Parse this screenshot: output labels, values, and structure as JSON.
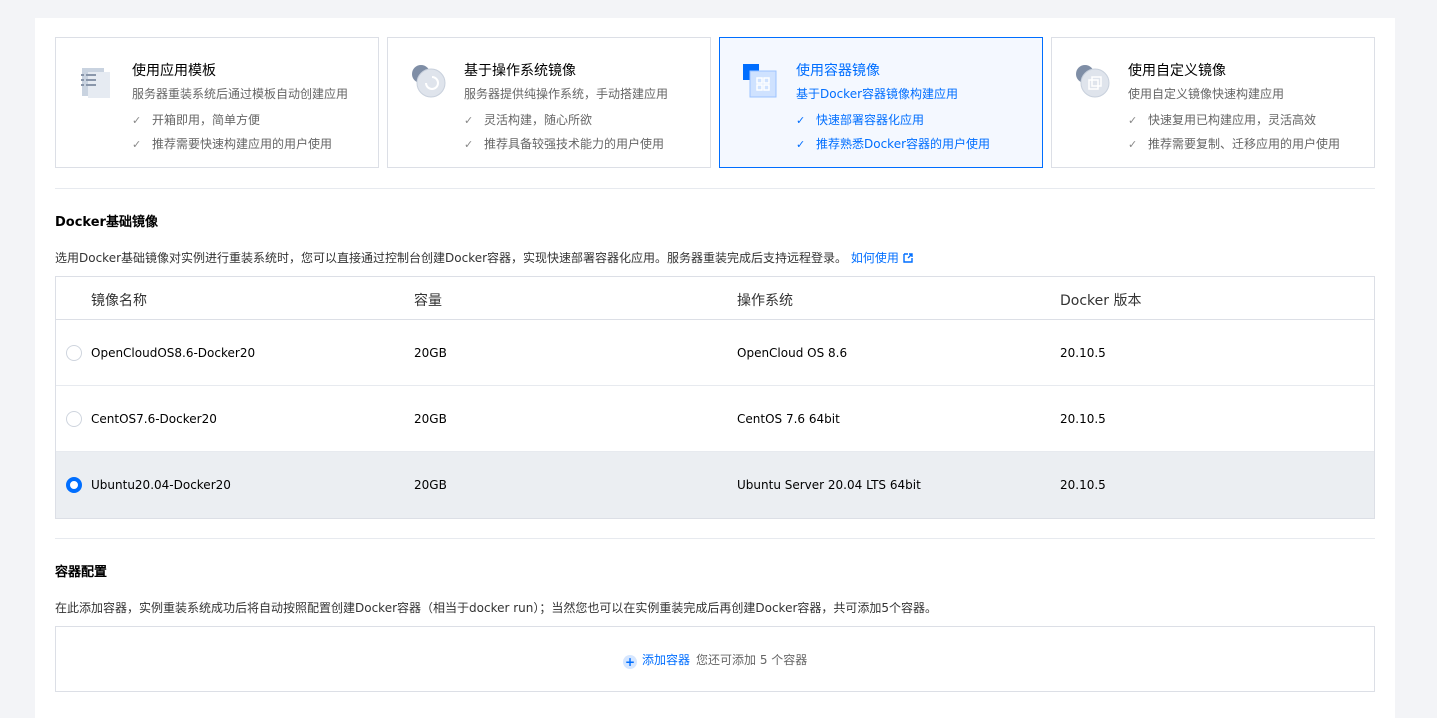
{
  "cards": [
    {
      "title": "使用应用模板",
      "desc": "服务器重装系统后通过模板自动创建应用",
      "features": [
        "开箱即用，简单方便",
        "推荐需要快速构建应用的用户使用"
      ],
      "icon": "app-template-icon",
      "active": false
    },
    {
      "title": "基于操作系统镜像",
      "desc": "服务器提供纯操作系统，手动搭建应用",
      "features": [
        "灵活构建，随心所欲",
        "推荐具备较强技术能力的用户使用"
      ],
      "icon": "os-image-icon",
      "active": false
    },
    {
      "title": "使用容器镜像",
      "desc": "基于Docker容器镜像构建应用",
      "features": [
        "快速部署容器化应用",
        "推荐熟悉Docker容器的用户使用"
      ],
      "icon": "container-image-icon",
      "active": true
    },
    {
      "title": "使用自定义镜像",
      "desc": "使用自定义镜像快速构建应用",
      "features": [
        "快速复用已构建应用，灵活高效",
        "推荐需要复制、迁移应用的用户使用"
      ],
      "icon": "custom-image-icon",
      "active": false
    }
  ],
  "docker": {
    "title": "Docker基础镜像",
    "desc": "选用Docker基础镜像对实例进行重装系统时，您可以直接通过控制台创建Docker容器，实现快速部署容器化应用。服务器重装完成后支持远程登录。",
    "link": "如何使用",
    "columns": [
      "镜像名称",
      "容量",
      "操作系统",
      "Docker 版本"
    ],
    "rows": [
      {
        "name": "OpenCloudOS8.6-Docker20",
        "size": "20GB",
        "os": "OpenCloud OS 8.6",
        "version": "20.10.5",
        "selected": false
      },
      {
        "name": "CentOS7.6-Docker20",
        "size": "20GB",
        "os": "CentOS 7.6 64bit",
        "version": "20.10.5",
        "selected": false
      },
      {
        "name": "Ubuntu20.04-Docker20",
        "size": "20GB",
        "os": "Ubuntu Server 20.04 LTS 64bit",
        "version": "20.10.5",
        "selected": true
      }
    ]
  },
  "container": {
    "title": "容器配置",
    "desc": "在此添加容器，实例重装系统成功后将自动按照配置创建Docker容器（相当于docker run）；当然您也可以在实例重装完成后再创建Docker容器，共可添加5个容器。",
    "add_label": "添加容器",
    "hint": "您还可添加 5 个容器"
  },
  "colors": {
    "accent": "#006eff",
    "selected_row": "#ebeef2",
    "border": "#dcdfe6"
  }
}
